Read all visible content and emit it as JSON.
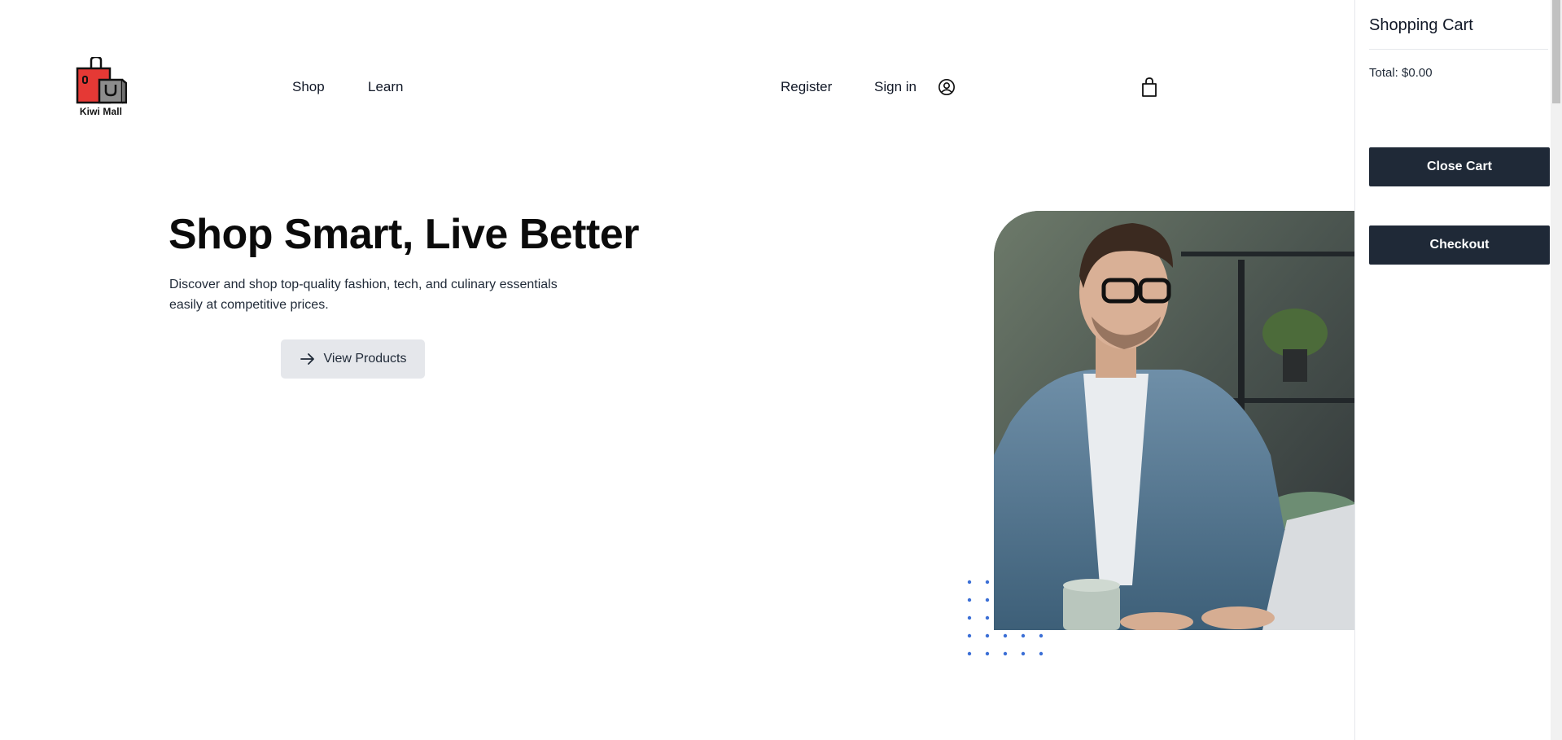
{
  "header": {
    "logo_text": "Kiwi Mall",
    "nav": {
      "shop": "Shop",
      "learn": "Learn"
    },
    "auth": {
      "register": "Register",
      "sign_in": "Sign in"
    },
    "icons": {
      "user": "user-circle-icon",
      "cart": "shopping-bag-icon"
    }
  },
  "hero": {
    "title": "Shop Smart, Live Better",
    "description": "Discover and shop top-quality fashion, tech, and culinary essentials easily at competitive prices.",
    "cta_label": "View Products",
    "cta_icon": "arrow-right-icon"
  },
  "cart": {
    "title": "Shopping Cart",
    "total": "Total: $0.00",
    "close_label": "Close Cart",
    "checkout_label": "Checkout"
  },
  "colors": {
    "accent_dark": "#1f2937",
    "button_light": "#e5e7eb",
    "dots_blue": "#3b6fd6",
    "logo_red": "#e53935",
    "logo_gray": "#8c8c8c"
  }
}
